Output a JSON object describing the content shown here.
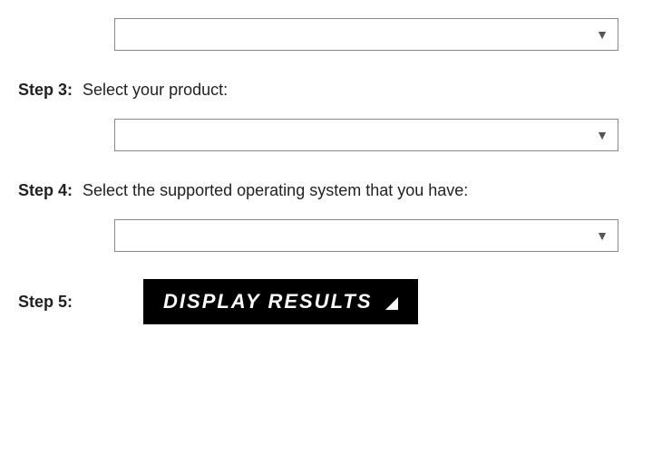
{
  "steps": {
    "s2": {
      "select_value": ""
    },
    "s3": {
      "num": "Step 3:",
      "text": "Select your product:",
      "select_value": ""
    },
    "s4": {
      "num": "Step 4:",
      "text": "Select the supported operating system that you have:",
      "select_value": ""
    },
    "s5": {
      "num": "Step 5:",
      "button_label": "DISPLAY RESULTS"
    }
  }
}
